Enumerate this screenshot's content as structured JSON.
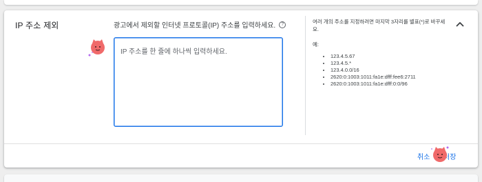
{
  "section": {
    "title": "IP 주소 제외"
  },
  "field": {
    "label": "광고에서 제외할 인터넷 프로토콜(IP) 주소를 입력하세요.",
    "help_icon_glyph": "?",
    "placeholder": "IP 주소를 한 줄에 하나씩 입력하세요."
  },
  "help": {
    "intro": "여러 개의 주소를 지정하려면 마지막 3자리를 별표(*)로 바꾸세요.",
    "example_label": "예:",
    "examples": [
      "123.4.5.67",
      "123.4.5.*",
      "123.4.0.0/16",
      "2620:0:1003:1011:fa1e:dfff:fee6:2711",
      "2620:0:1003:1011:fa1e:dfff:0:0/96"
    ]
  },
  "actions": {
    "cancel_label": "취소",
    "save_label": "저장"
  },
  "icons": {
    "collapse": "chevron-up-icon",
    "help": "help-circle-icon",
    "mascot": "pink-cat-mascot-icon"
  },
  "colors": {
    "accent": "#1a73e8",
    "mascot": "#f06a6a"
  }
}
